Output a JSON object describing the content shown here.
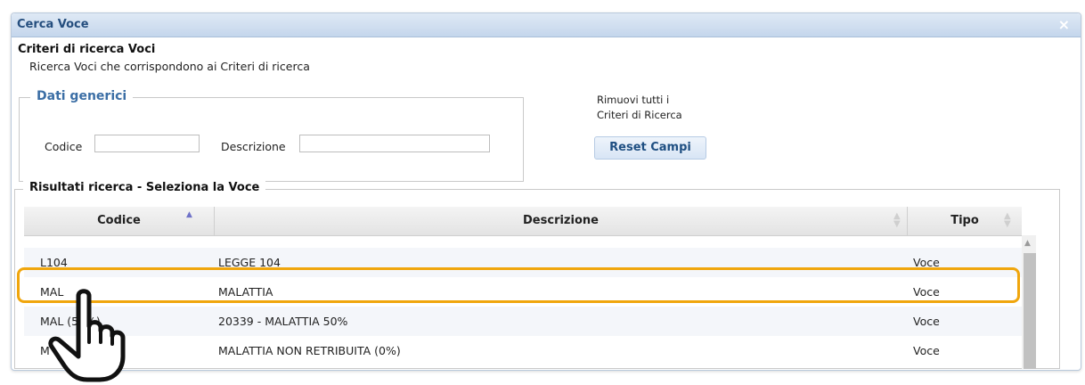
{
  "dialog": {
    "title": "Cerca Voce",
    "close_glyph": "×"
  },
  "criteria": {
    "title": "Criteri di ricerca Voci",
    "subtitle": "Ricerca Voci che corrispondono ai Criteri di ricerca"
  },
  "generic": {
    "legend": "Dati generici",
    "codice_label": "Codice",
    "codice_value": "",
    "descrizione_label": "Descrizione",
    "descrizione_value": ""
  },
  "reset": {
    "note_line1": "Rimuovi tutti i",
    "note_line2": "Criteri di Ricerca",
    "button_label": "Reset Campi"
  },
  "results": {
    "title": "Risultati ricerca - Seleziona la Voce",
    "columns": [
      "Codice",
      "Descrizione",
      "Tipo"
    ],
    "rows": [
      {
        "codice": "L104",
        "descrizione": "LEGGE 104",
        "tipo": "Voce"
      },
      {
        "codice": "MAL",
        "descrizione": "MALATTIA",
        "tipo": "Voce"
      },
      {
        "codice": "MAL (50%)",
        "descrizione": "20339 - MALATTIA 50%",
        "tipo": "Voce"
      },
      {
        "codice": "M",
        "descrizione": "MALATTIA NON RETRIBUITA (0%)",
        "tipo": "Voce"
      }
    ],
    "selected_row_index": 1
  },
  "colors": {
    "title_text": "#254e7e",
    "legend_text": "#3b6ea5",
    "highlight": "#f0a60d"
  },
  "icons": {
    "cursor": "pointing-hand-cursor-icon",
    "sort_asc": "sort-ascending-icon",
    "sort_neutral": "sort-neutral-icon"
  }
}
